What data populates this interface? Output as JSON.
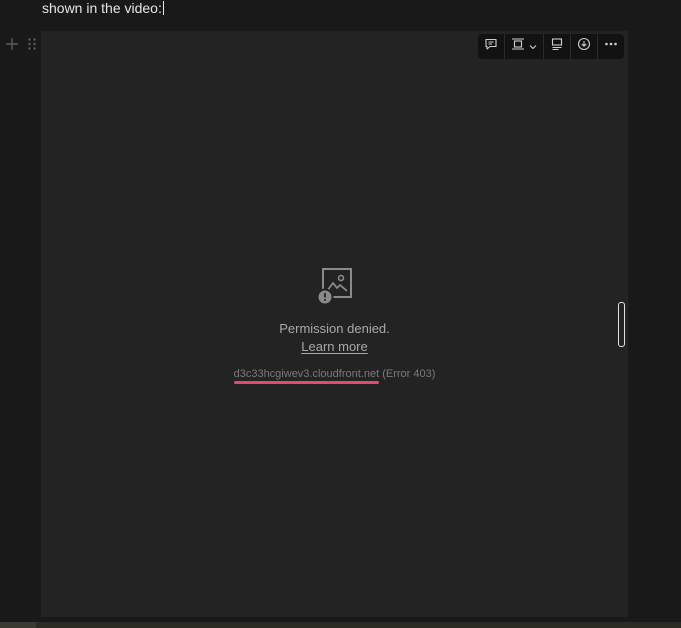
{
  "document": {
    "text_line": "shown in the video:"
  },
  "block": {
    "add_icon": "plus-icon",
    "drag_icon": "drag-handle-icon"
  },
  "toolbar": {
    "icons": [
      "comment-icon",
      "align-icon",
      "chevron-down-icon",
      "caption-icon",
      "download-icon",
      "more-icon"
    ]
  },
  "image_error": {
    "icon": "broken-image-icon",
    "title": "Permission denied.",
    "link_label": "Learn more",
    "domain": "d3c33hcgiwev3.cloudfront.net",
    "error_code": "(Error 403)",
    "underline_color": "#e34a6f"
  }
}
